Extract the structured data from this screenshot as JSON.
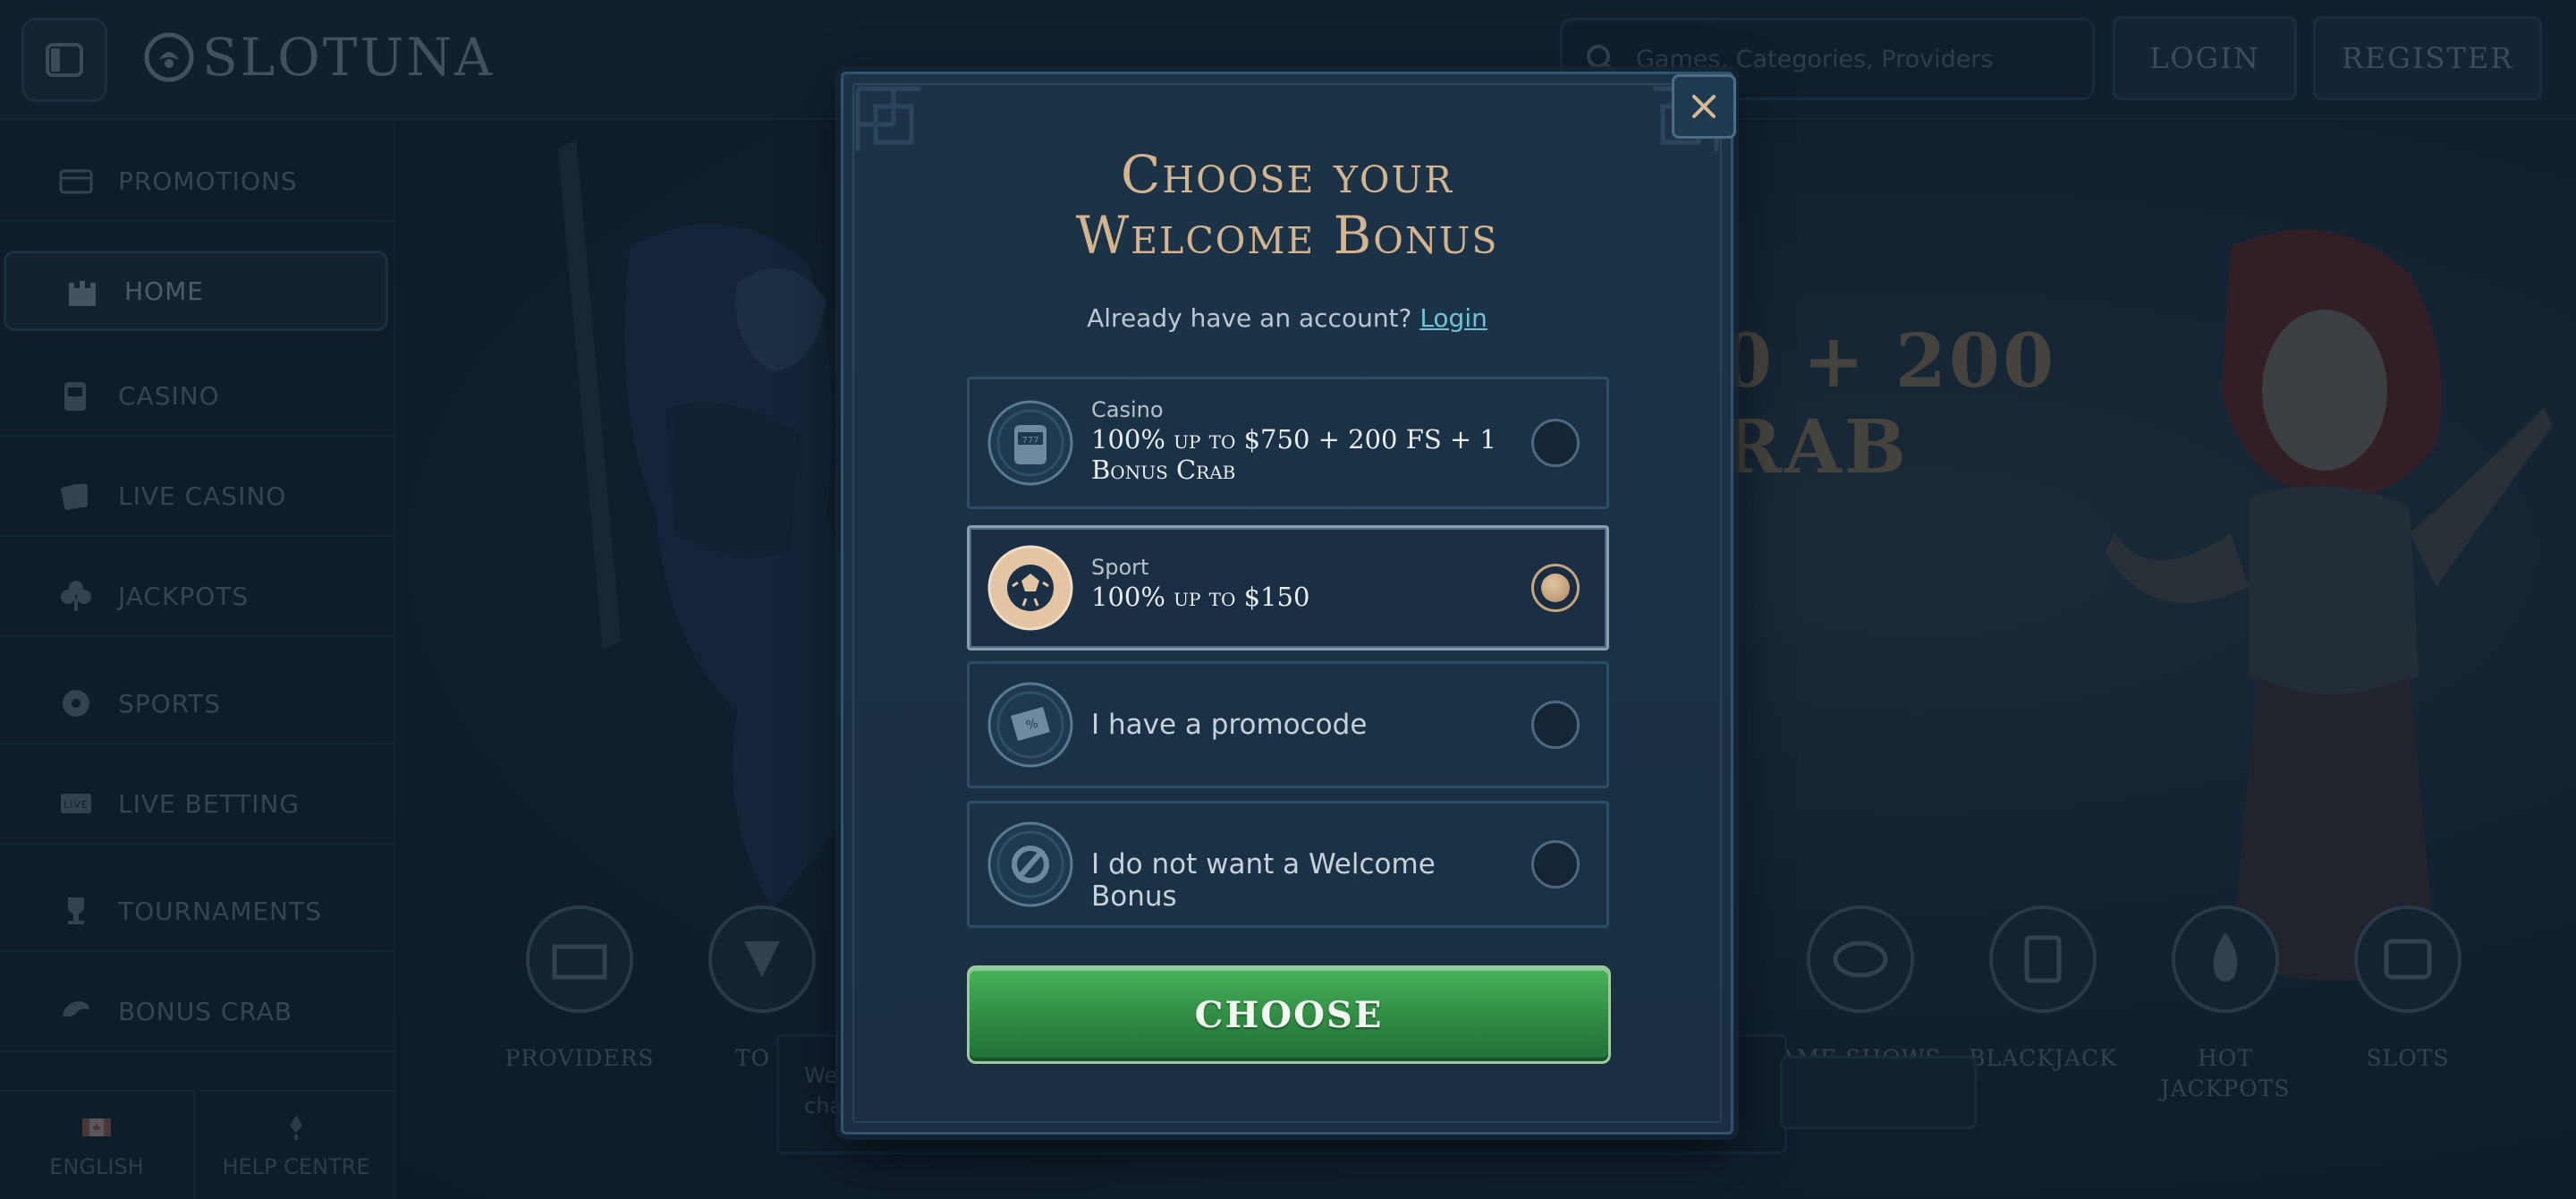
{
  "header": {
    "logo_text": "SLOTUNA",
    "search_placeholder": "Games, Categories, Providers",
    "login_label": "LOGIN",
    "register_label": "REGISTER"
  },
  "sidebar": {
    "items": [
      {
        "label": "PROMOTIONS",
        "icon": "promotions-icon"
      },
      {
        "label": "HOME",
        "icon": "castle-icon",
        "active": true
      },
      {
        "label": "CASINO",
        "icon": "slot-machine-icon"
      },
      {
        "label": "LIVE CASINO",
        "icon": "cards-icon"
      },
      {
        "label": "JACKPOTS",
        "icon": "clover-icon"
      },
      {
        "label": "SPORTS",
        "icon": "ball-icon"
      },
      {
        "label": "LIVE BETTING",
        "icon": "live-icon"
      },
      {
        "label": "TOURNAMENTS",
        "icon": "trophy-icon"
      },
      {
        "label": "BONUS CRAB",
        "icon": "crab-icon"
      }
    ],
    "language_label": "ENGLISH",
    "help_label": "HELP CENTRE"
  },
  "hero": {
    "text_line1": "0 + 200",
    "text_line2": "RAB"
  },
  "categories": [
    {
      "label": "PROVIDERS"
    },
    {
      "label": "TO"
    },
    {
      "label": "AME SHOWS"
    },
    {
      "label": "BLACKJACK"
    },
    {
      "label": "HOT JACKPOTS"
    },
    {
      "label": "SLOTS"
    }
  ],
  "cookie_text": "We\ncha",
  "modal": {
    "title_line1": "Choose your",
    "title_line2": "Welcome Bonus",
    "subtitle": "Already have an account?",
    "login_link": "Login",
    "options": [
      {
        "category": "Casino",
        "title": "100% up to $750 + 200 FS + 1 Bonus Crab",
        "icon": "slot-machine-icon",
        "selected": false
      },
      {
        "category": "Sport",
        "title": "100% up to $150",
        "icon": "soccer-ball-icon",
        "selected": true
      },
      {
        "title": "I have a promocode",
        "icon": "ticket-icon",
        "selected": false
      },
      {
        "title": "I do not want a Welcome Bonus",
        "icon": "no-symbol-icon",
        "selected": false
      }
    ],
    "choose_label": "CHOOSE"
  },
  "colors": {
    "accent_gold": "#d3b48f",
    "link": "#6fc3d3",
    "choose_green": "#2f8b42"
  }
}
